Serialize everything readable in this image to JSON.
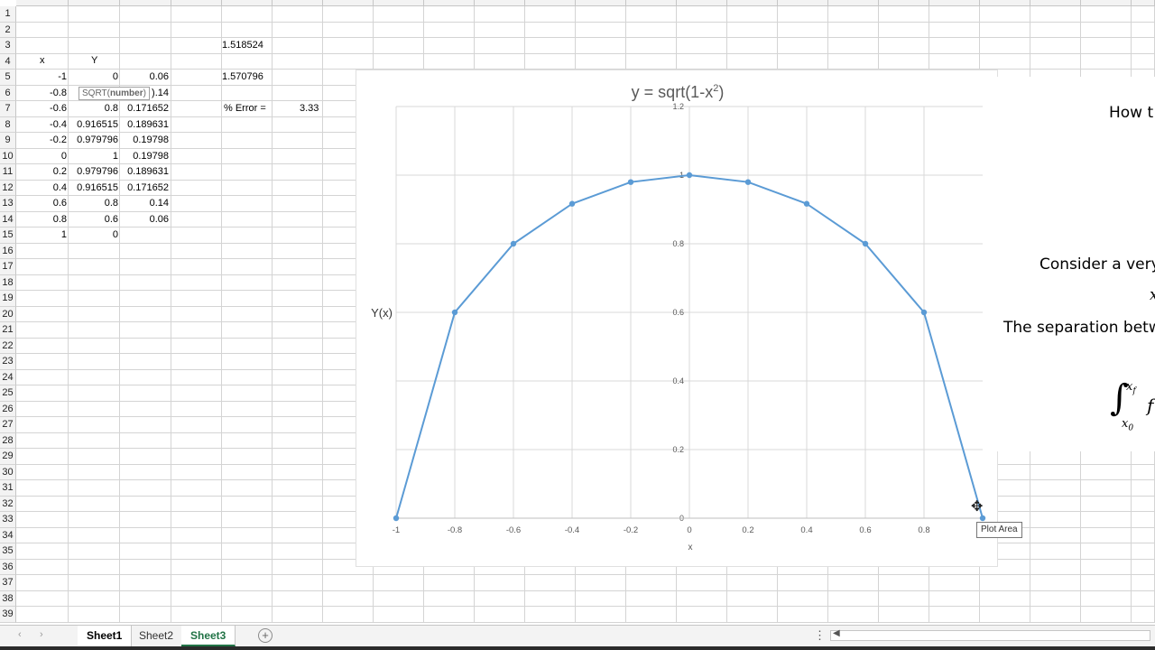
{
  "spreadsheet": {
    "row_numbers": [
      "1",
      "2",
      "3",
      "4",
      "5",
      "6",
      "7",
      "8",
      "9",
      "10",
      "11",
      "12",
      "13",
      "14",
      "15",
      "16",
      "17",
      "18",
      "19",
      "20",
      "21",
      "22",
      "23",
      "24",
      "25",
      "26",
      "27",
      "28",
      "29",
      "30",
      "31",
      "32",
      "33",
      "34",
      "35",
      "36",
      "37",
      "38",
      "39"
    ],
    "header_labels": {
      "x": "x",
      "y": "Y"
    },
    "data_rows": [
      {
        "x": "-1",
        "y": "0",
        "area": "0.06"
      },
      {
        "x": "-0.8",
        "y": "",
        "area": ").14"
      },
      {
        "x": "-0.6",
        "y": "0.8",
        "area": "0.171652"
      },
      {
        "x": "-0.4",
        "y": "0.916515",
        "area": "0.189631"
      },
      {
        "x": "-0.2",
        "y": "0.979796",
        "area": "0.19798"
      },
      {
        "x": "0",
        "y": "1",
        "area": "0.19798"
      },
      {
        "x": "0.2",
        "y": "0.979796",
        "area": "0.189631"
      },
      {
        "x": "0.4",
        "y": "0.916515",
        "area": "0.171652"
      },
      {
        "x": "0.6",
        "y": "0.8",
        "area": "0.14"
      },
      {
        "x": "0.8",
        "y": "0.6",
        "area": "0.06"
      },
      {
        "x": "1",
        "y": "0",
        "area": ""
      }
    ],
    "sum_value": "1.518524",
    "exact_value": "1.570796",
    "error_label": "% Error =",
    "error_value": "3.33",
    "formula_tooltip": {
      "func": "SQRT(",
      "arg": "number",
      "close": ")"
    }
  },
  "chart": {
    "title_main": "y = sqrt(1-x",
    "title_sup": "2",
    "title_end": ")",
    "plot_area_tooltip": "Plot Area"
  },
  "chart_data": {
    "type": "line",
    "title": "y = sqrt(1-x²)",
    "xlabel": "x",
    "ylabel": "Y(x)",
    "x": [
      -1,
      -0.8,
      -0.6,
      -0.4,
      -0.2,
      0,
      0.2,
      0.4,
      0.6,
      0.8,
      1
    ],
    "series": [
      {
        "values": [
          0,
          0.6,
          0.8,
          0.916515,
          0.979796,
          1,
          0.979796,
          0.916515,
          0.8,
          0.6,
          0
        ]
      }
    ],
    "xlim": [
      -1,
      1
    ],
    "ylim": [
      0,
      1.2
    ],
    "x_ticks": [
      "-1",
      "-0.8",
      "-0.6",
      "-0.4",
      "-0.2",
      "0",
      "0.2",
      "0.4",
      "0.6",
      "0.8"
    ],
    "y_ticks": [
      "0",
      "0.2",
      "0.4",
      "0.6",
      "0.8",
      "1",
      "1.2"
    ],
    "grid": true,
    "line_color": "#5b9bd5"
  },
  "overlay_text": {
    "line1": "How t",
    "line2": "Consider a very",
    "line3": "x",
    "line4": "The separation betw",
    "integral_upper": "x",
    "integral_upper_sub": "f",
    "integral_lower": "x",
    "integral_lower_sub": "0",
    "integral_f": "f"
  },
  "sheet_tabs": [
    {
      "label": "Sheet1"
    },
    {
      "label": "Sheet2"
    },
    {
      "label": "Sheet3"
    }
  ],
  "tab_nav": {
    "prev": "‹",
    "next": "›",
    "add": "+",
    "more": "⋮",
    "scroll_left": "◀"
  },
  "colors": {
    "accent": "#217346",
    "series": "#5b9bd5",
    "grid": "#d9d9d9"
  }
}
